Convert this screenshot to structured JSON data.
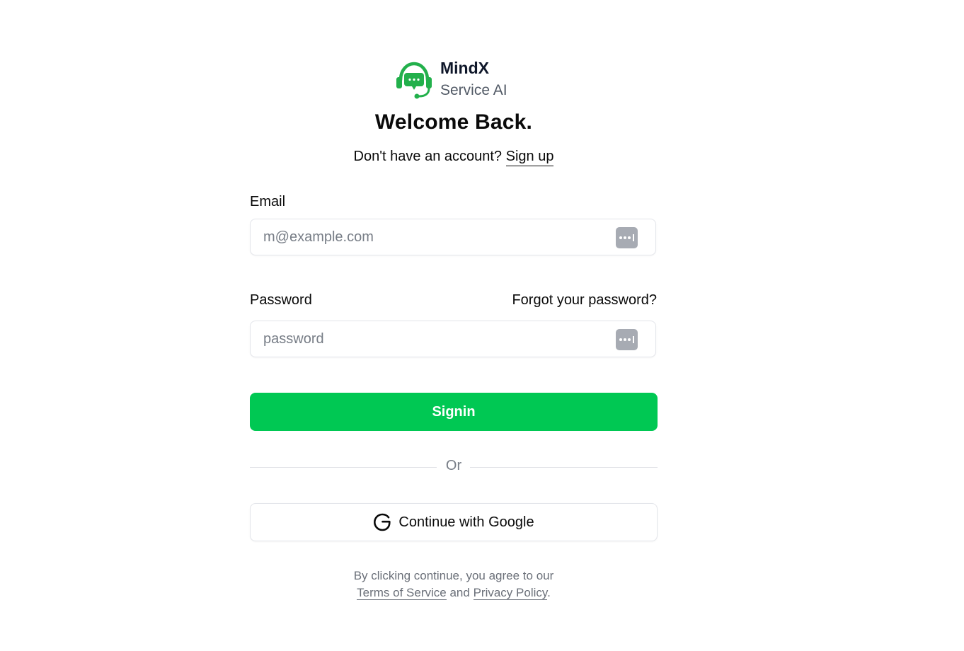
{
  "brand": {
    "name": "MindX",
    "subtitle": "Service AI",
    "accent_color": "#22b04b"
  },
  "heading": "Welcome Back.",
  "signup": {
    "prompt": "Don't have an account?",
    "link_label": "Sign up"
  },
  "email": {
    "label": "Email",
    "value": "",
    "placeholder": "m@example.com",
    "icon": "password-manager-icon"
  },
  "password": {
    "label": "Password",
    "forgot_label": "Forgot your password?",
    "value": "",
    "placeholder": "password",
    "icon": "password-manager-icon"
  },
  "signin": {
    "label": "Signin",
    "color": "#00c853"
  },
  "divider": {
    "label": "Or"
  },
  "google": {
    "label": "Continue with Google",
    "icon": "google-g-icon"
  },
  "legal": {
    "prefix": "By clicking continue, you agree to our",
    "terms_label": "Terms of Service",
    "conjunction": "and",
    "privacy_label": "Privacy Policy",
    "suffix": "."
  }
}
